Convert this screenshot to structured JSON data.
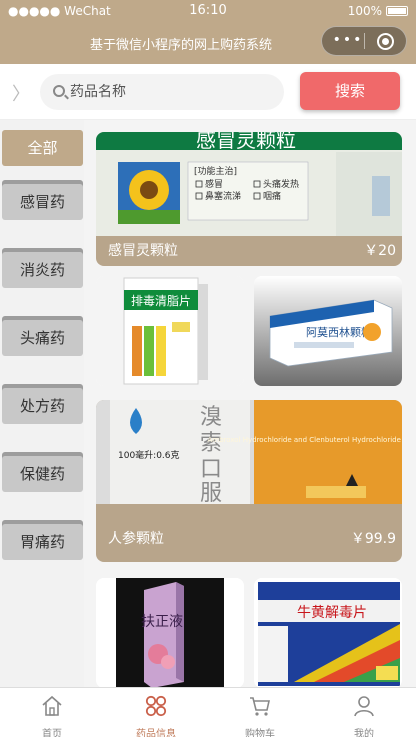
{
  "status": {
    "carrier": "●●●●● WeChat",
    "time": "16:10",
    "battery": "100%"
  },
  "nav": {
    "title": "基于微信小程序的网上购药系统",
    "capsule_dots": "•••"
  },
  "search": {
    "placeholder": "药品名称",
    "button": "搜索",
    "expand_glyph": "〉"
  },
  "categories": [
    {
      "label": "全部",
      "active": true
    },
    {
      "label": "感冒药",
      "active": false
    },
    {
      "label": "消炎药",
      "active": false
    },
    {
      "label": "头痛药",
      "active": false
    },
    {
      "label": "处方药",
      "active": false
    },
    {
      "label": "保健药",
      "active": false
    },
    {
      "label": "胃痛药",
      "active": false
    }
  ],
  "products": {
    "feature1": {
      "name": "感冒灵颗粒",
      "price": "￥20"
    },
    "feature2": {
      "name": "人参颗粒",
      "price": "￥99.9"
    },
    "pack_texts": {
      "p1_title": "感冒灵颗粒",
      "p2_title": "排毒清脂片",
      "p3_title": "阿莫西林颗粒",
      "p4_title": "溴索口服",
      "p4_sub": "100毫升:0.6克",
      "p4_eng": "Ambroxol Hydrochloride and Clenbuterol Hydrochloride Oral Solution",
      "p5_title": "扶正液",
      "p6_title": "牛黄解毒片",
      "p1_panel": "[功能主治]",
      "p1_items": [
        "感冒",
        "头痛发热",
        "鼻塞流涕",
        "咽痛"
      ]
    }
  },
  "tabs": [
    {
      "label": "首页",
      "icon": "home-icon"
    },
    {
      "label": "药品信息",
      "icon": "grid-icon",
      "active": true
    },
    {
      "label": "购物车",
      "icon": "cart-icon"
    },
    {
      "label": "我的",
      "icon": "user-icon"
    }
  ],
  "colors": {
    "theme": "#bfa98a",
    "search_button": "#f0696a",
    "active_tab": "#bf7a59"
  }
}
